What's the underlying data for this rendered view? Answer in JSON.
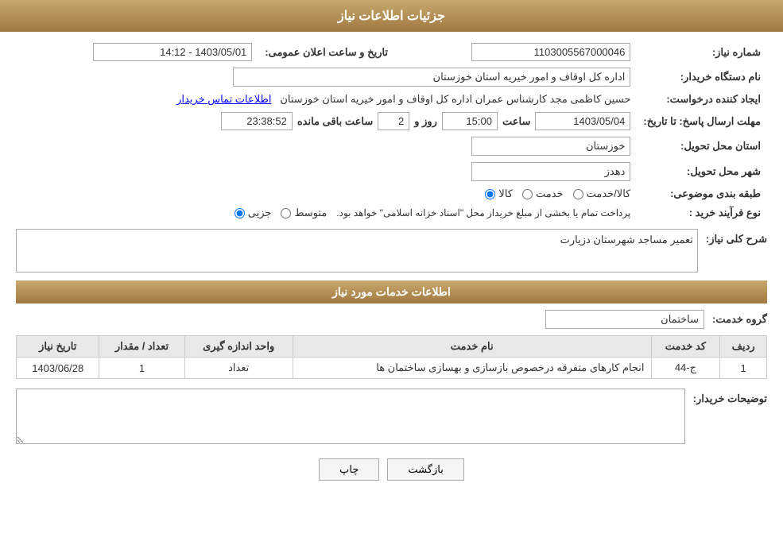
{
  "page": {
    "title": "جزئیات اطلاعات نیاز"
  },
  "header": {
    "announcement_date_label": "تاریخ و ساعت اعلان عمومی:",
    "announcement_date_value": "1403/05/01 - 14:12",
    "need_number_label": "شماره نیاز:",
    "need_number_value": "1103005567000046",
    "buyer_org_label": "نام دستگاه خریدار:",
    "buyer_org_value": "اداره کل اوقاف و امور خیریه استان خوزستان",
    "creator_label": "ایجاد کننده درخواست:",
    "creator_name": "حسین کاظمی مجد کارشناس عمران اداره کل اوقاف و امور خیریه استان خوزستان",
    "creator_link": "اطلاعات تماس خریدار",
    "deadline_label": "مهلت ارسال پاسخ: تا تاریخ:",
    "deadline_date": "1403/05/04",
    "deadline_time_label": "ساعت",
    "deadline_time": "15:00",
    "deadline_day_label": "روز و",
    "deadline_days": "2",
    "deadline_remaining_label": "ساعت باقی مانده",
    "deadline_remaining": "23:38:52",
    "province_label": "استان محل تحویل:",
    "province_value": "خوزستان",
    "city_label": "شهر محل تحویل:",
    "city_value": "دهدز",
    "category_label": "طبقه بندی موضوعی:",
    "category_options": [
      "کالا",
      "خدمت",
      "کالا/خدمت"
    ],
    "category_selected": "کالا",
    "process_label": "نوع فرآیند خرید :",
    "process_options": [
      "جزیی",
      "متوسط"
    ],
    "process_note": "پرداخت تمام یا بخشی از مبلغ خریداز محل \"اسناد خزانه اسلامی\" خواهد بود.",
    "description_label": "شرح کلی نیاز:",
    "description_value": "تعمیر مساجد شهرستان دزیارت"
  },
  "services_section": {
    "title": "اطلاعات خدمات مورد نیاز",
    "service_group_label": "گروه خدمت:",
    "service_group_value": "ساختمان",
    "table": {
      "columns": [
        "ردیف",
        "کد خدمت",
        "نام خدمت",
        "واحد اندازه گیری",
        "تعداد / مقدار",
        "تاریخ نیاز"
      ],
      "rows": [
        {
          "row_num": "1",
          "service_code": "ج-44",
          "service_name": "انجام کارهای متفرقه درخصوص بازسازی و بهسازی ساختمان ها",
          "unit": "تعداد",
          "quantity": "1",
          "date": "1403/06/28"
        }
      ]
    }
  },
  "buyer_notes": {
    "label": "توضیحات خریدار:",
    "value": ""
  },
  "buttons": {
    "print": "چاپ",
    "back": "بازگشت"
  }
}
